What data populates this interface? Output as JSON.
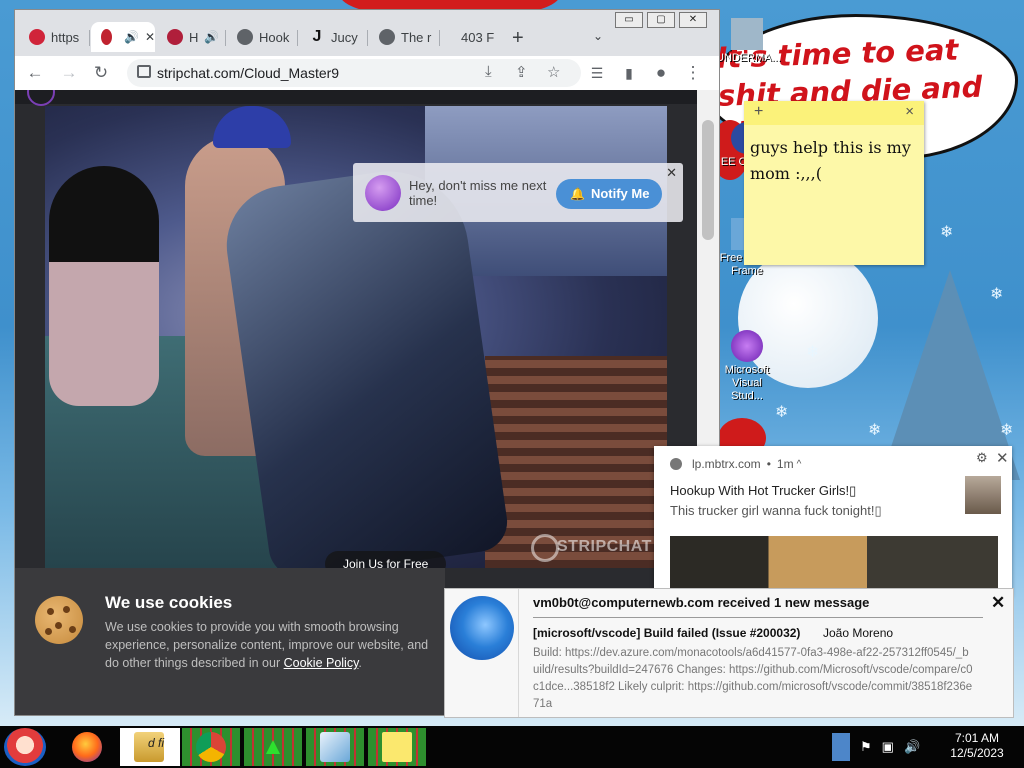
{
  "desktop": {
    "bubble_text": "It's time to eat shit and die and chew",
    "icons": [
      {
        "label": "UNDERMA..."
      },
      {
        "label": "EE C... TH F"
      },
      {
        "label": "Free Photo Frame"
      },
      {
        "label": "Microsoft Visual Stud..."
      }
    ],
    "sticky_note": {
      "add_icon": "+",
      "close_icon": "×",
      "text": "guys help this is my mom :,,,("
    }
  },
  "browser": {
    "window_controls": {
      "minimize": "▭",
      "maximize": "▢",
      "close": "✕"
    },
    "tabs": [
      {
        "label": "https",
        "color": "#d0243a"
      },
      {
        "label": "",
        "color": "#c0232f",
        "audio": "🔊",
        "close": "✕"
      },
      {
        "label": "H",
        "color": "#b01f3b",
        "audio": "🔊"
      },
      {
        "label": "Hook",
        "color": "#5f6368"
      },
      {
        "label": "Jucy",
        "color": "#111111",
        "glyph": "J"
      },
      {
        "label": "The r",
        "color": "#5f6368"
      },
      {
        "label": "403 F",
        "color": "#dfe1e5"
      }
    ],
    "new_tab": "+",
    "tab_search": "⌄",
    "url": "stripchat.com/Cloud_Master9",
    "page": {
      "notify_popup": {
        "text": "Hey, don't miss me next time!",
        "button": "Notify Me",
        "close": "✕"
      },
      "join_button": "Join Us for Free",
      "watermark": "STRIPCHAT",
      "cookie_banner": {
        "title": "We use cookies",
        "text": "We use cookies to provide you with smooth browsing experience, personalize content, improve our website, and do other things described in our",
        "link": "Cookie Policy",
        "trail": "."
      }
    }
  },
  "chrome_notification": {
    "source": "lp.mbtrx.com",
    "age": "1m",
    "title": "Hookup With Hot Trucker Girls!▯",
    "body": "This trucker girl wanna fuck tonight!▯"
  },
  "mail_notification": {
    "header": "vm0b0t@computernewb.com received 1 new message",
    "subject": "[microsoft/vscode] Build failed (Issue #200032)",
    "from": "João Moreno",
    "body": "Build: https://dev.azure.com/monacotools/a6d41577-0fa3-498e-af22-257312ff0545/_build/results?buildId=247676 Changes: https://github.com/Microsoft/vscode/compare/c0c1dce...38518f2 Likely culprit: https://github.com/microsoft/vscode/commit/38518f236e71a"
  },
  "taskbar": {
    "partial_label": "d fi",
    "clock": {
      "time": "7:01 AM",
      "date": "12/5/2023"
    }
  }
}
